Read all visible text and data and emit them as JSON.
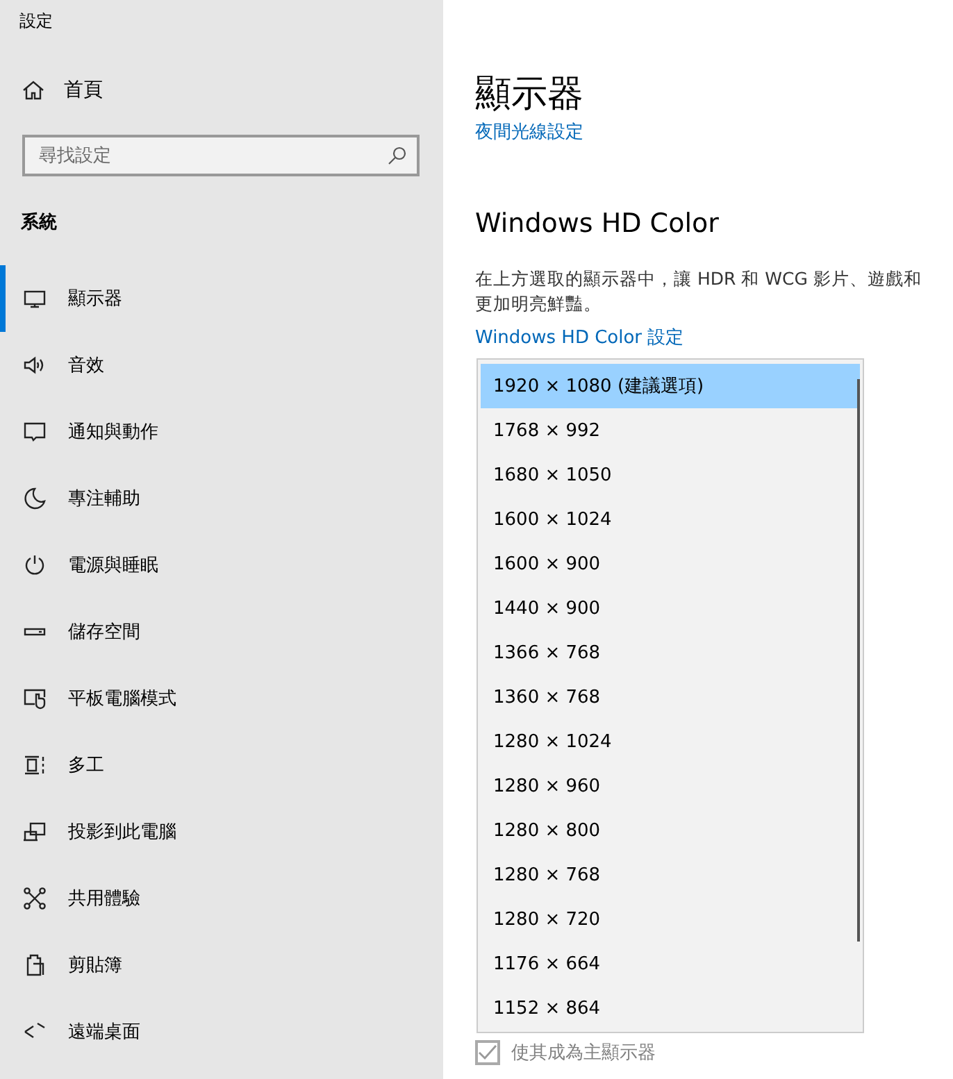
{
  "window": {
    "title": "設定"
  },
  "sidebar": {
    "home": "首頁",
    "search": {
      "placeholder": "尋找設定"
    },
    "section": "系統",
    "items": [
      {
        "label": "顯示器",
        "selected": true
      },
      {
        "label": "音效",
        "selected": false
      },
      {
        "label": "通知與動作",
        "selected": false
      },
      {
        "label": "專注輔助",
        "selected": false
      },
      {
        "label": "電源與睡眠",
        "selected": false
      },
      {
        "label": "儲存空間",
        "selected": false
      },
      {
        "label": "平板電腦模式",
        "selected": false
      },
      {
        "label": "多工",
        "selected": false
      },
      {
        "label": "投影到此電腦",
        "selected": false
      },
      {
        "label": "共用體驗",
        "selected": false
      },
      {
        "label": "剪貼簿",
        "selected": false
      },
      {
        "label": "遠端桌面",
        "selected": false
      }
    ]
  },
  "main": {
    "title": "顯示器",
    "night_light_link": "夜間光線設定",
    "hd_heading": "Windows HD Color",
    "hd_description": [
      "在上方選取的顯示器中，讓 HDR 和 WCG 影片、遊戲和",
      "更加明亮鮮豔。"
    ],
    "hd_link": "Windows HD Color 設定",
    "primary_checkbox": {
      "label": "使其成為主顯示器",
      "checked": true,
      "disabled": true
    }
  },
  "resolution_dropdown": {
    "options": [
      {
        "label": "1920 × 1080 (建議選項)",
        "selected": true
      },
      {
        "label": "1768 × 992",
        "selected": false
      },
      {
        "label": "1680 × 1050",
        "selected": false
      },
      {
        "label": "1600 × 1024",
        "selected": false
      },
      {
        "label": "1600 × 900",
        "selected": false
      },
      {
        "label": "1440 × 900",
        "selected": false
      },
      {
        "label": "1366 × 768",
        "selected": false
      },
      {
        "label": "1360 × 768",
        "selected": false
      },
      {
        "label": "1280 × 1024",
        "selected": false
      },
      {
        "label": "1280 × 960",
        "selected": false
      },
      {
        "label": "1280 × 800",
        "selected": false
      },
      {
        "label": "1280 × 768",
        "selected": false
      },
      {
        "label": "1280 × 720",
        "selected": false
      },
      {
        "label": "1176 × 664",
        "selected": false
      },
      {
        "label": "1152 × 864",
        "selected": false
      }
    ]
  }
}
